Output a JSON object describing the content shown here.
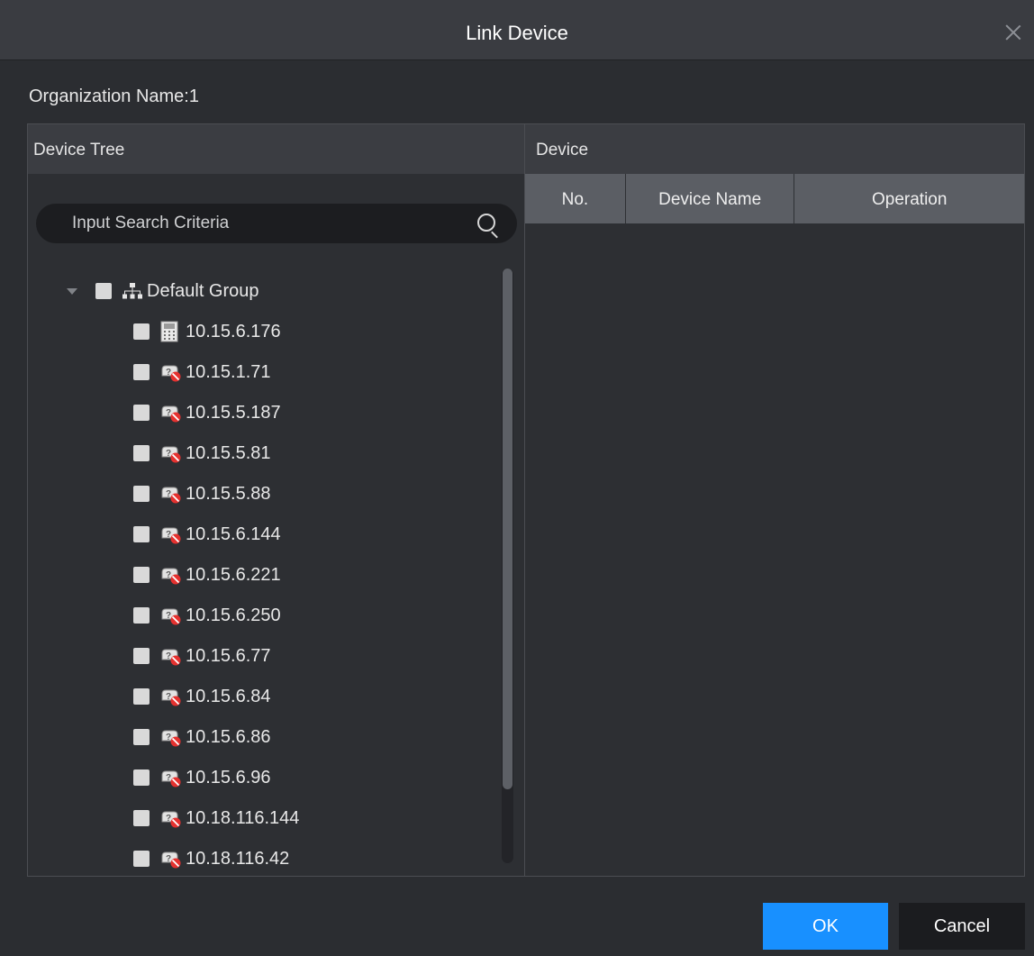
{
  "dialog": {
    "title": "Link Device"
  },
  "organization": {
    "label": "Organization Name:1"
  },
  "device_tree": {
    "header": "Device Tree",
    "search_placeholder": "Input Search Criteria",
    "group": {
      "label": "Default Group",
      "icon": "org-tree-icon",
      "expanded": true
    },
    "devices": [
      {
        "label": "10.15.6.176",
        "icon": "access-controller-icon"
      },
      {
        "label": "10.15.1.71",
        "icon": "offline-device-icon"
      },
      {
        "label": "10.15.5.187",
        "icon": "offline-device-icon"
      },
      {
        "label": "10.15.5.81",
        "icon": "offline-device-icon"
      },
      {
        "label": "10.15.5.88",
        "icon": "offline-device-icon"
      },
      {
        "label": "10.15.6.144",
        "icon": "offline-device-icon"
      },
      {
        "label": "10.15.6.221",
        "icon": "offline-device-icon"
      },
      {
        "label": "10.15.6.250",
        "icon": "offline-device-icon"
      },
      {
        "label": "10.15.6.77",
        "icon": "offline-device-icon"
      },
      {
        "label": "10.15.6.84",
        "icon": "offline-device-icon"
      },
      {
        "label": "10.15.6.86",
        "icon": "offline-device-icon"
      },
      {
        "label": "10.15.6.96",
        "icon": "offline-device-icon"
      },
      {
        "label": "10.18.116.144",
        "icon": "offline-device-icon"
      },
      {
        "label": "10.18.116.42",
        "icon": "offline-device-icon"
      }
    ]
  },
  "device_panel": {
    "header": "Device",
    "columns": [
      "No.",
      "Device Name",
      "Operation"
    ],
    "rows": []
  },
  "buttons": {
    "ok": "OK",
    "cancel": "Cancel"
  },
  "colors": {
    "accent": "#1890ff",
    "offline_badge": "#e5312f"
  }
}
